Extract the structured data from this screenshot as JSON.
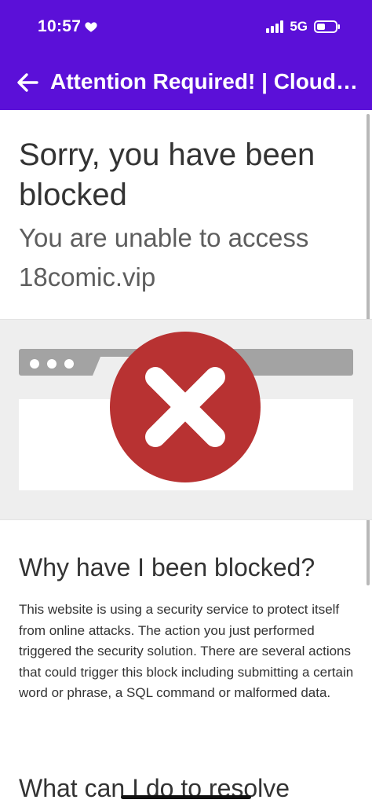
{
  "status_bar": {
    "time": "10:57",
    "network": "5G",
    "icons": [
      "heart-icon",
      "signal-icon",
      "battery-icon"
    ]
  },
  "app_bar": {
    "title": "Attention Required! | Cloud…",
    "back_icon": "arrow-left-icon"
  },
  "page": {
    "headline": "Sorry, you have been blocked",
    "subheadline": "You are unable to access 18comic.vip",
    "illustration_icons": [
      "browser-window-icon",
      "blocked-x-icon"
    ],
    "why_heading": "Why have I been blocked?",
    "why_body": "This website is using a security service to protect itself from online attacks. The action you just performed triggered the security solution. There are several actions that could trigger this block including submitting a certain word or phrase, a SQL command or malformed data.",
    "resolve_heading": "What can I do to resolve"
  },
  "colors": {
    "app_bar": "#5b10d8",
    "blocked_red": "#b83232",
    "browser_gray": "#a3a3a3"
  }
}
